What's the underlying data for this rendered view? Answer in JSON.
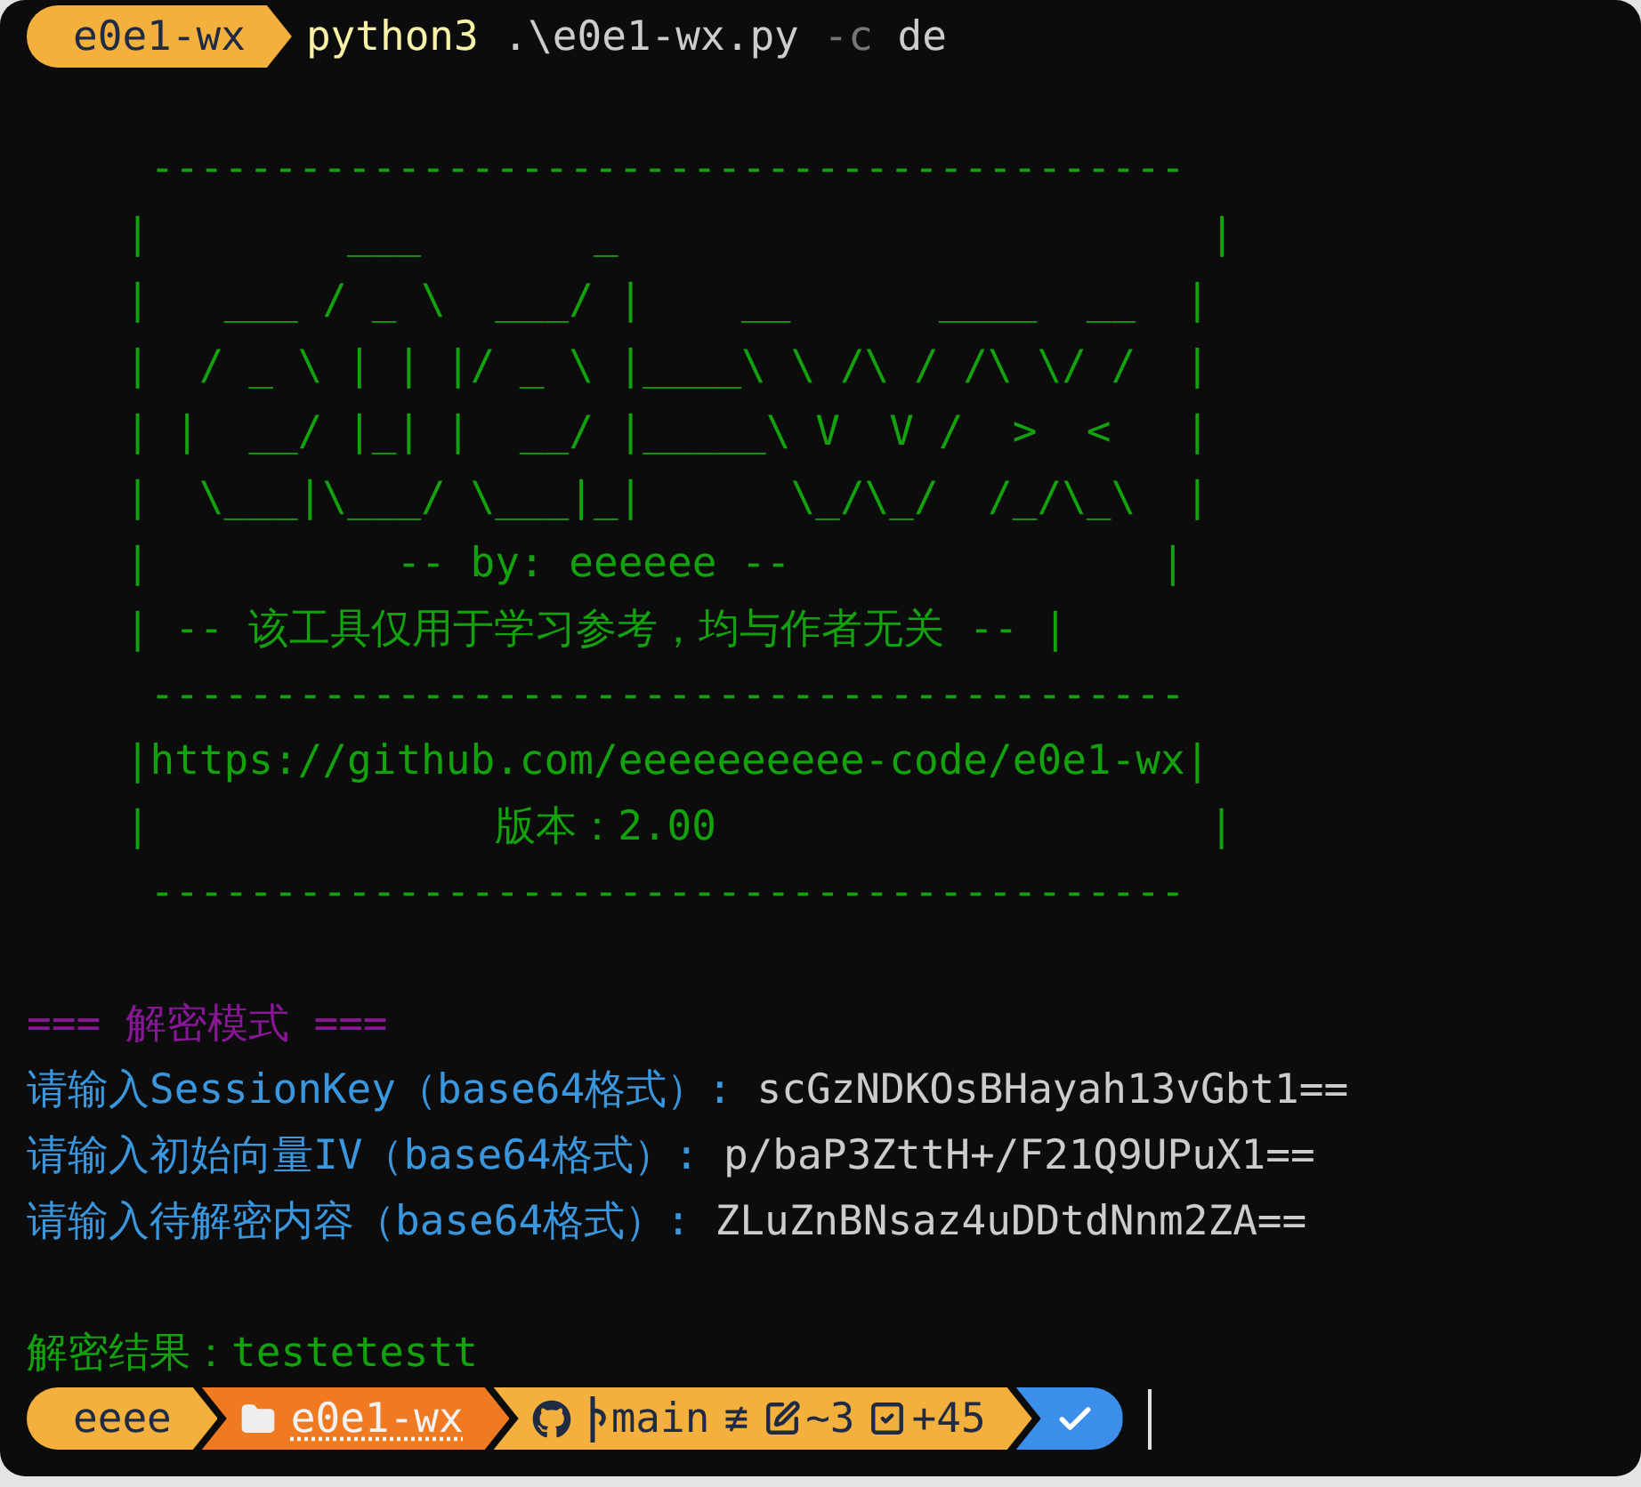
{
  "prompt": {
    "segment": "e0e1-wx",
    "command": "python3",
    "args": [
      {
        "kind": "path",
        "text": ".\\e0e1-wx.py"
      },
      {
        "kind": "flag",
        "text": "-c"
      },
      {
        "kind": "value",
        "text": "de"
      }
    ]
  },
  "banner": [
    {
      "kind": "rule",
      "text": "------------------------------------------"
    },
    {
      "kind": "art",
      "text": "|        ___       _                        |"
    },
    {
      "kind": "art",
      "text": "|   ___ / _ \\  ___/ |    __      ____  __  |"
    },
    {
      "kind": "art",
      "text": "|  / _ \\ | | |/ _ \\ |____\\ \\ /\\ / /\\ \\/ /  |"
    },
    {
      "kind": "art",
      "text": "| |  __/ |_| |  __/ |_____\\ V  V /  >  <   |"
    },
    {
      "kind": "art",
      "text": "|  \\___|\\___/ \\___|_|      \\_/\\_/  /_/\\_\\  |"
    },
    {
      "kind": "art",
      "text": "|          -- by: eeeeee --               |"
    },
    {
      "kind": "art",
      "text": "| -- 该工具仅用于学习参考，均与作者无关 -- |"
    },
    {
      "kind": "rule",
      "text": "------------------------------------------"
    },
    {
      "kind": "art",
      "text": "|https://github.com/eeeeeeeeee-code/e0e1-wx|"
    },
    {
      "kind": "art",
      "text": "|              版本：2.00                    |"
    },
    {
      "kind": "rule",
      "text": "------------------------------------------"
    }
  ],
  "mode_header": "=== 解密模式 ===",
  "inputs": [
    {
      "prompt": "请输入SessionKey（base64格式）:",
      "value": "scGzNDKOsBHayah13vGbt1=="
    },
    {
      "prompt": "请输入初始向量IV（base64格式）:",
      "value": "p/baP3ZttH+/F21Q9UPuX1=="
    },
    {
      "prompt": "请输入待解密内容（base64格式）:",
      "value": "ZLuZnBNsaz4uDDtdNnm2ZA=="
    }
  ],
  "result": {
    "label": "解密结果：",
    "value": "testetestt"
  },
  "status_bar": [
    {
      "kind": "user",
      "text": "eeee"
    },
    {
      "kind": "folder",
      "text": "e0e1-wx"
    },
    {
      "kind": "git",
      "branch": "main",
      "sync": "≢",
      "modified": "~3",
      "staged": "+45"
    },
    {
      "kind": "status"
    }
  ]
}
